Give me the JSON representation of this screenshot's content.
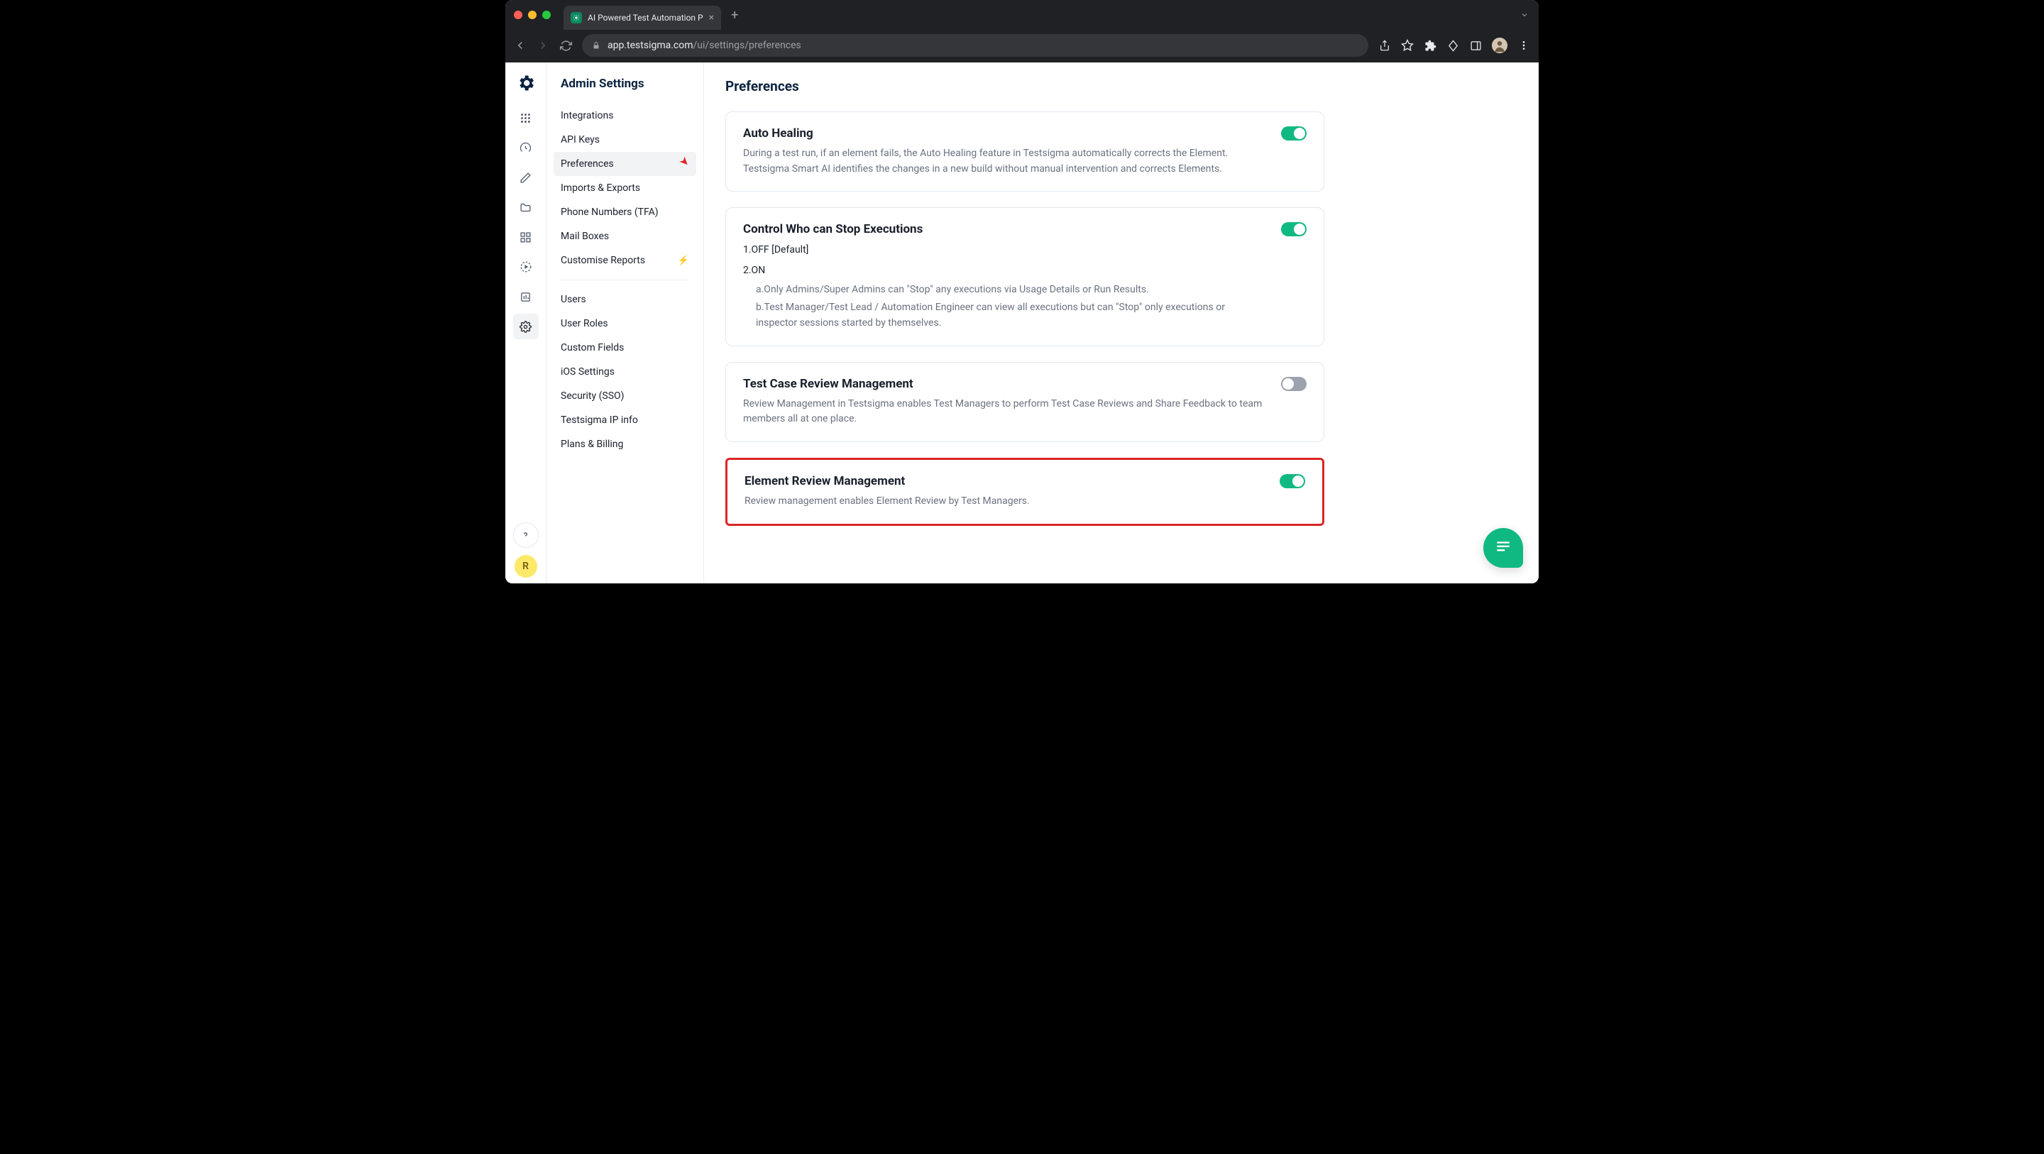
{
  "browser": {
    "tab_title": "AI Powered Test Automation P",
    "url_host": "app.testsigma.com",
    "url_path": "/ui/settings/preferences"
  },
  "sidebar": {
    "title": "Admin Settings",
    "group1": [
      {
        "label": "Integrations"
      },
      {
        "label": "API Keys"
      },
      {
        "label": "Preferences",
        "active": true,
        "annotated": true
      },
      {
        "label": "Imports & Exports"
      },
      {
        "label": "Phone Numbers (TFA)"
      },
      {
        "label": "Mail Boxes"
      },
      {
        "label": "Customise Reports",
        "bolt": true
      }
    ],
    "group2": [
      {
        "label": "Users"
      },
      {
        "label": "User Roles"
      },
      {
        "label": "Custom Fields"
      },
      {
        "label": "iOS Settings"
      },
      {
        "label": "Security (SSO)"
      },
      {
        "label": "Testsigma IP info"
      },
      {
        "label": "Plans & Billing"
      }
    ]
  },
  "rail_avatar": "R",
  "main": {
    "heading": "Preferences",
    "cards": [
      {
        "title": "Auto Healing",
        "desc": "During a test run, if an element fails, the Auto Healing feature in Testsigma automatically corrects the Element. Testsigma Smart AI identifies the changes in a new build without manual intervention and corrects Elements.",
        "on": true
      },
      {
        "title": "Control Who can Stop Executions",
        "sub1": "1.OFF [Default]",
        "sub2": "2.ON",
        "list_a": "a.Only Admins/Super Admins can \"Stop\" any executions via Usage Details or Run Results.",
        "list_b": "b.Test Manager/Test Lead / Automation Engineer can view all executions but can \"Stop\" only executions or inspector sessions started by themselves.",
        "on": true
      },
      {
        "title": "Test Case Review Management",
        "desc": "Review Management in Testsigma enables Test Managers to perform Test Case Reviews and Share Feedback to team members all at one place.",
        "on": false
      },
      {
        "title": "Element Review Management",
        "desc": "Review management enables Element Review by Test Managers.",
        "on": true,
        "highlighted": true
      }
    ]
  }
}
